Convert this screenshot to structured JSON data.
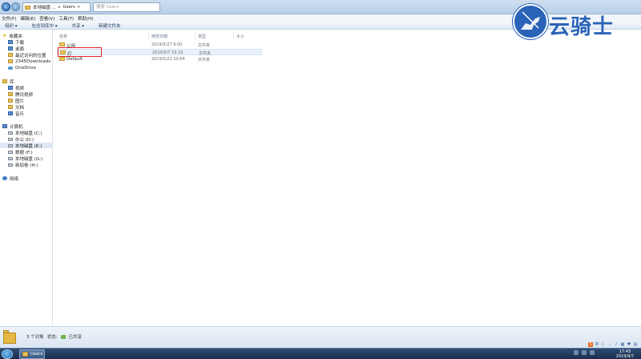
{
  "address": {
    "crumbs": [
      "本地磁盘 ...",
      "Users"
    ],
    "search_placeholder": "搜索 Users"
  },
  "menu": [
    "文件(F)",
    "编辑(E)",
    "查看(V)",
    "工具(T)",
    "帮助(H)"
  ],
  "toolbar": [
    "组织 ▾",
    "包含到库中 ▾",
    "共享 ▾",
    "新建文件夹"
  ],
  "sidebar": {
    "favorites": {
      "title": "收藏夹",
      "items": [
        "下载",
        "桌面",
        "最近访问的位置",
        "2345Downloads",
        "OneDrive"
      ]
    },
    "libraries": {
      "title": "库",
      "items": [
        "视频",
        "腾讯视频",
        "图片",
        "文档",
        "音乐"
      ]
    },
    "computer": {
      "title": "计算机",
      "items": [
        "本地磁盘 (C:)",
        "办公 (D:)",
        "本地磁盘 (E:)",
        "数据 (F:)",
        "本地磁盘 (G:)",
        "新加卷 (H:)"
      ],
      "selected": "本地磁盘 (E:)"
    },
    "network": {
      "title": "网络"
    }
  },
  "columns": {
    "name": "名称",
    "date": "修改日期",
    "type": "类型",
    "size": "大小"
  },
  "files": [
    {
      "name": "公用",
      "date": "2019/5/27 9:00",
      "type": "文件夹"
    },
    {
      "name": "灯",
      "date": "2019/9/7 15:10",
      "type": "文件夹"
    },
    {
      "name": "Default",
      "date": "2019/5/22 10:04",
      "type": "文件夹"
    }
  ],
  "status": {
    "count": "3 个对象",
    "state_label": "状态:",
    "state_value": "已共享"
  },
  "taskbar": {
    "window_label": "Users",
    "time": "17:43",
    "date": "2019/9/7"
  },
  "watermark": {
    "text": "云骑士"
  },
  "colors": {
    "highlight": "#e02424",
    "brand": "#2a63b8"
  }
}
